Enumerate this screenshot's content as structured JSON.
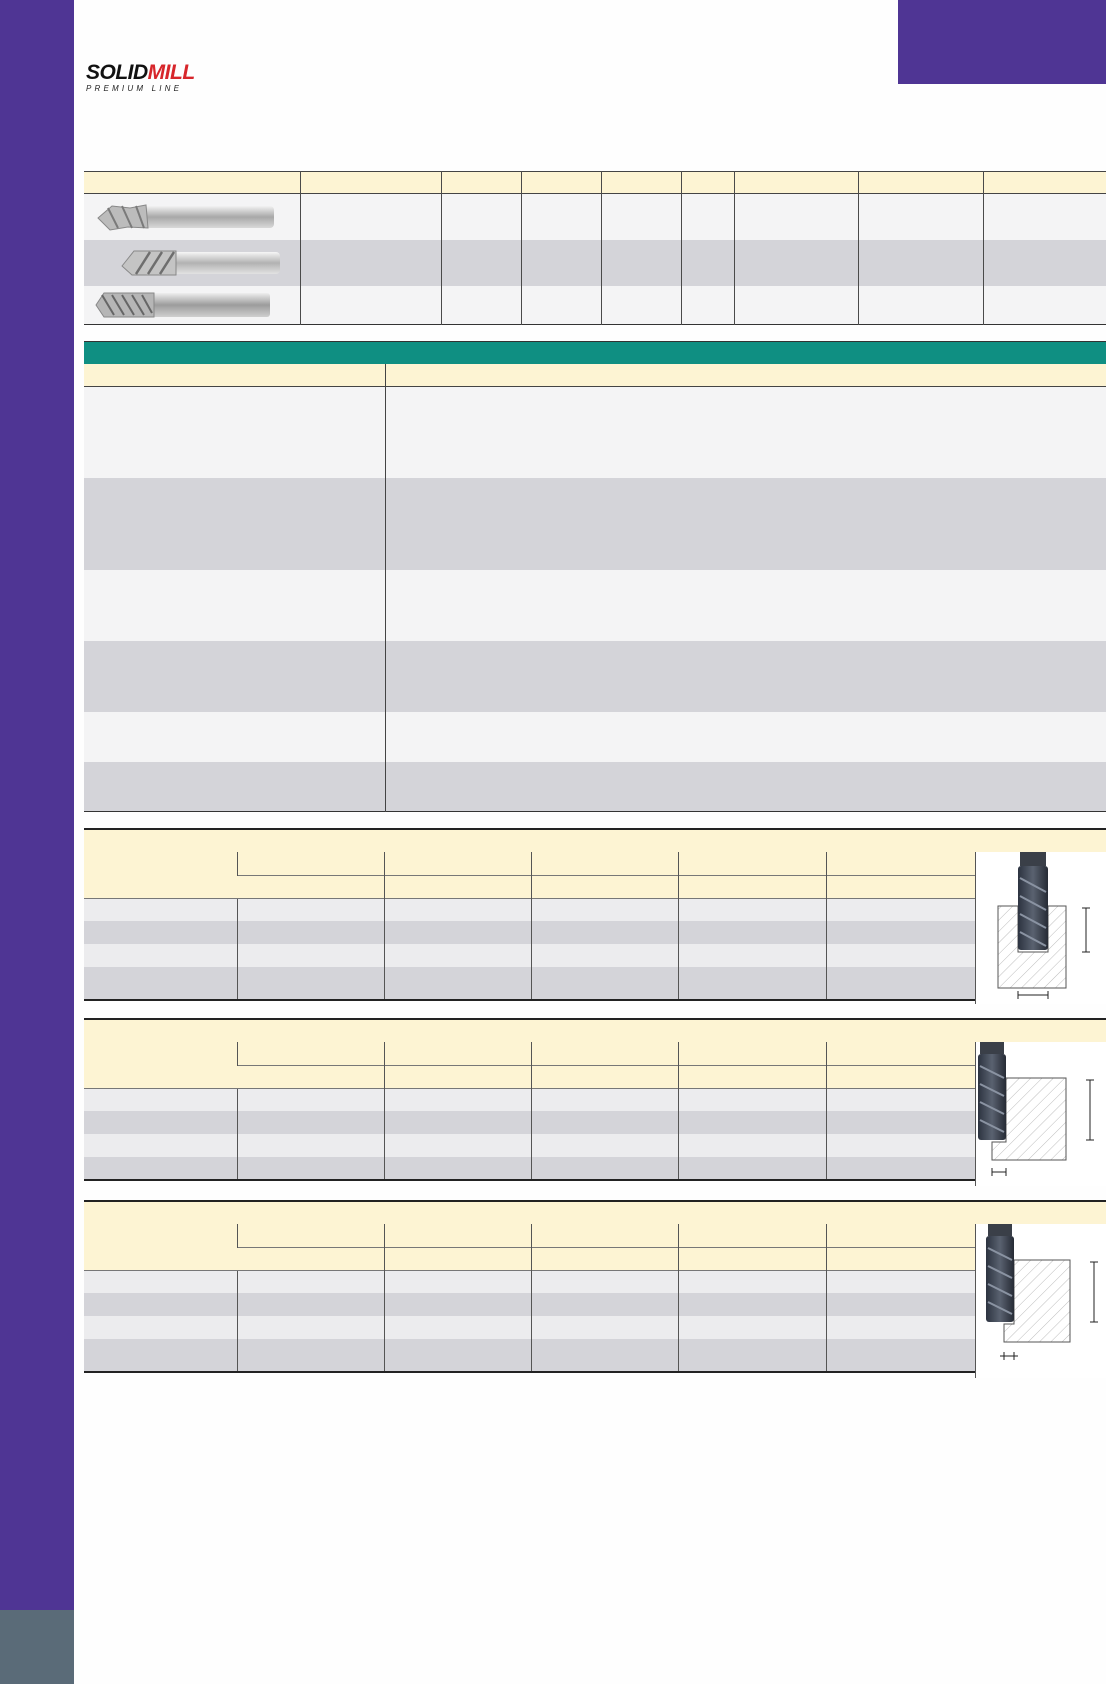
{
  "brand": {
    "logo_solid": "SOLID",
    "logo_mill": "MILL",
    "logo_sub": "PREMIUM LINE",
    "colors": {
      "sidebar": "#4f3594",
      "sidebar_bottom": "#5a6b78",
      "section_green": "#0f8f82",
      "header_yellow": "#fdf4d3",
      "logo_red": "#d7262b"
    }
  },
  "tool_images": [
    "end-mill-icon",
    "end-mill-icon",
    "end-mill-icon"
  ],
  "diagrams": [
    "slotting-diagram-icon",
    "side-milling-diagram-icon",
    "side-finishing-diagram-icon"
  ]
}
